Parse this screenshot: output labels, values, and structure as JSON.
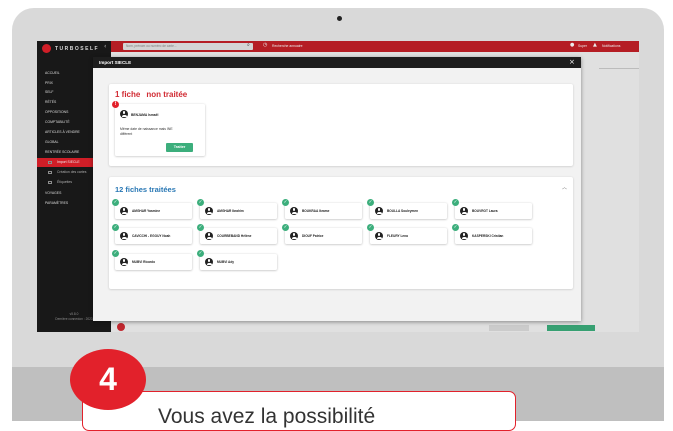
{
  "app": {
    "logo_text": "TURBOSELF",
    "collapse_icon": "chevron-left-icon"
  },
  "topbar": {
    "search_placeholder": "Nom, prénom ou numéro de carte...",
    "recent": "Recherche annuaire",
    "user": "Super",
    "notifications": "Notifications"
  },
  "sidebar": {
    "items": [
      {
        "label": "ACCUEIL"
      },
      {
        "label": "PRIX"
      },
      {
        "label": "SELF"
      },
      {
        "label": "RÉTÉS"
      },
      {
        "label": "OPPOSITIONS"
      },
      {
        "label": "COMPTABILITÉ"
      },
      {
        "label": "ARTICLES À VENDRE"
      },
      {
        "label": "GLOBAL"
      },
      {
        "label": "RENTRÉE SCOLAIRE"
      }
    ],
    "subitems": [
      {
        "label": "Import SIECLE"
      },
      {
        "label": "Création des cartes"
      },
      {
        "label": "Étiquettes"
      }
    ],
    "items_after": [
      {
        "label": "VOYAGES"
      },
      {
        "label": "PARAMÈTRES"
      }
    ],
    "footer_version": "v5.8.0",
    "footer_user": "Dernière connexion : 2023"
  },
  "modal": {
    "title": "Import SIECLE",
    "pending": {
      "heading_count": "1 fiche",
      "heading_label": "non traitée",
      "badge": "!",
      "name": "BENJAMA Ismaël",
      "message": "Même date de naissance mais INE différent",
      "button": "Traiter"
    },
    "processed": {
      "heading": "12 fiches traitées",
      "check": "✓",
      "fiches": [
        "AMGHAR Yasmine",
        "AMGHAR Ibrahim",
        "BOUKRAA Ikrame",
        "BOULLA Souleymen",
        "BOUVROT Laura",
        "CAVICCHI - EGOUY Noah",
        "COURBEBAND Hélène",
        "DIOUF Patrice",
        "FLEURY Lena",
        "KASPERSKI Cristian",
        "MUBVI Ricardo",
        "MUBVI Ady"
      ]
    }
  },
  "tutorial": {
    "step_number": "4",
    "callout_text": "Vous avez la possibilité"
  },
  "colors": {
    "brand_red": "#e2212b",
    "topbar_red": "#c52028",
    "success_green": "#3cae7c",
    "heading_blue": "#2877b4",
    "sidebar_dark": "#1b1b1b"
  }
}
